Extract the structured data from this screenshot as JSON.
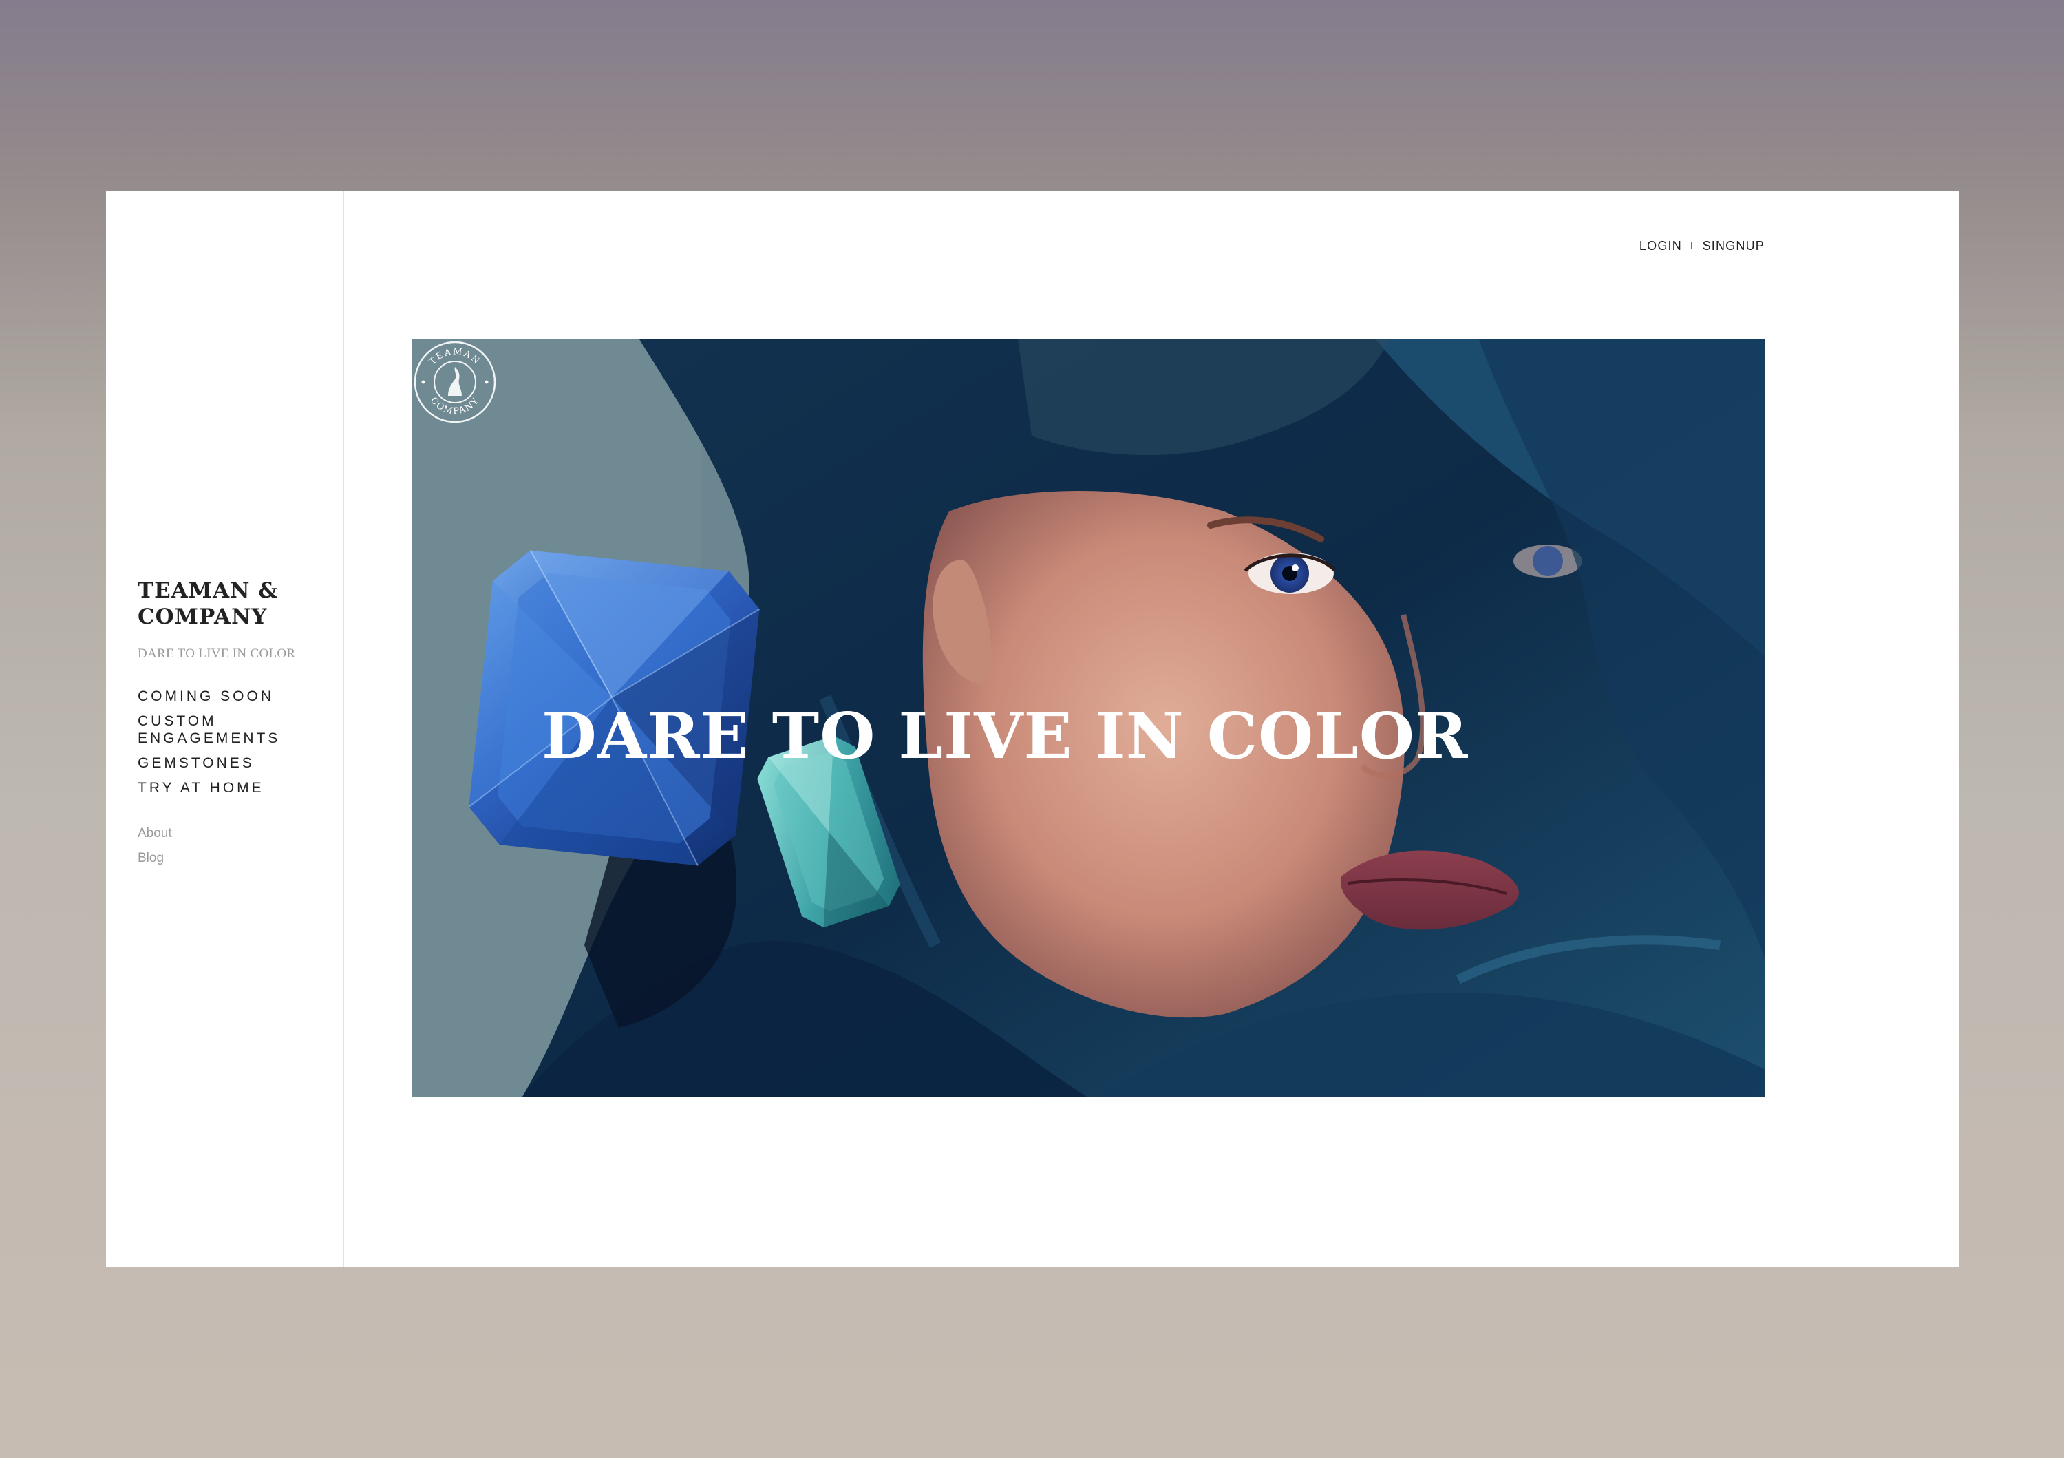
{
  "brand": {
    "name_line1": "TEAMAN &",
    "name_line2": "COMPANY",
    "tagline": "DARE TO LIVE IN COLOR"
  },
  "nav": {
    "primary": [
      {
        "label": "COMING SOON"
      },
      {
        "label": "CUSTOM ENGAGEMENTS"
      },
      {
        "label": "GEMSTONES"
      },
      {
        "label": "TRY AT HOME"
      }
    ],
    "secondary": [
      {
        "label": "About"
      },
      {
        "label": "Blog"
      }
    ]
  },
  "header": {
    "login_label": "LOGIN",
    "separator": "I",
    "signup_label": "SINGNUP"
  },
  "hero": {
    "headline": "DARE TO LIVE IN COLOR",
    "seal_top_text": "TEAMAN",
    "seal_bottom_text": "COMPANY"
  },
  "colors": {
    "hero_backdrop": "#6b8690",
    "veil": "#0f2f4d",
    "sapphire": "#2d5fb4",
    "aquamarine": "#3fa2a6",
    "text_dark": "#222222",
    "text_muted": "#9a9a9a"
  }
}
